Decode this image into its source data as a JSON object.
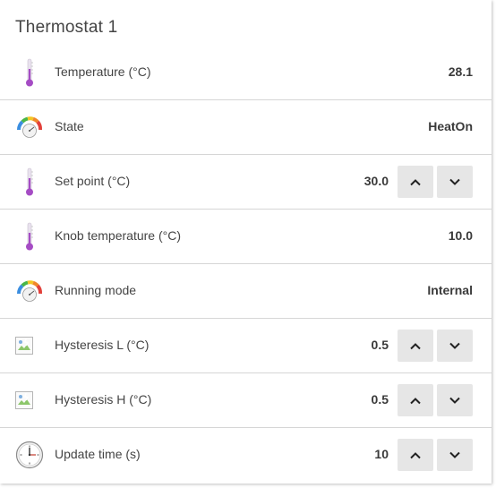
{
  "card": {
    "title": "Thermostat 1"
  },
  "rows": [
    {
      "icon": "thermometer-icon",
      "label": "Temperature (°C)",
      "value": "28.1",
      "controls": false
    },
    {
      "icon": "gauge-icon",
      "label": "State",
      "value": "HeatOn",
      "controls": false
    },
    {
      "icon": "thermometer-icon",
      "label": "Set point (°C)",
      "value": "30.0",
      "controls": true
    },
    {
      "icon": "thermometer-icon",
      "label": "Knob temperature (°C)",
      "value": "10.0",
      "controls": false
    },
    {
      "icon": "gauge-icon",
      "label": "Running mode",
      "value": "Internal",
      "controls": false
    },
    {
      "icon": "broken-image-icon",
      "label": "Hysteresis L (°C)",
      "value": "0.5",
      "controls": true
    },
    {
      "icon": "broken-image-icon",
      "label": "Hysteresis H (°C)",
      "value": "0.5",
      "controls": true
    },
    {
      "icon": "clock-icon",
      "label": "Update time (s)",
      "value": "10",
      "controls": true
    }
  ],
  "colors": {
    "thermometer": "#a54cc4",
    "button_bg": "#e6e6e6",
    "divider": "#d6d6d6",
    "text": "#444444"
  }
}
